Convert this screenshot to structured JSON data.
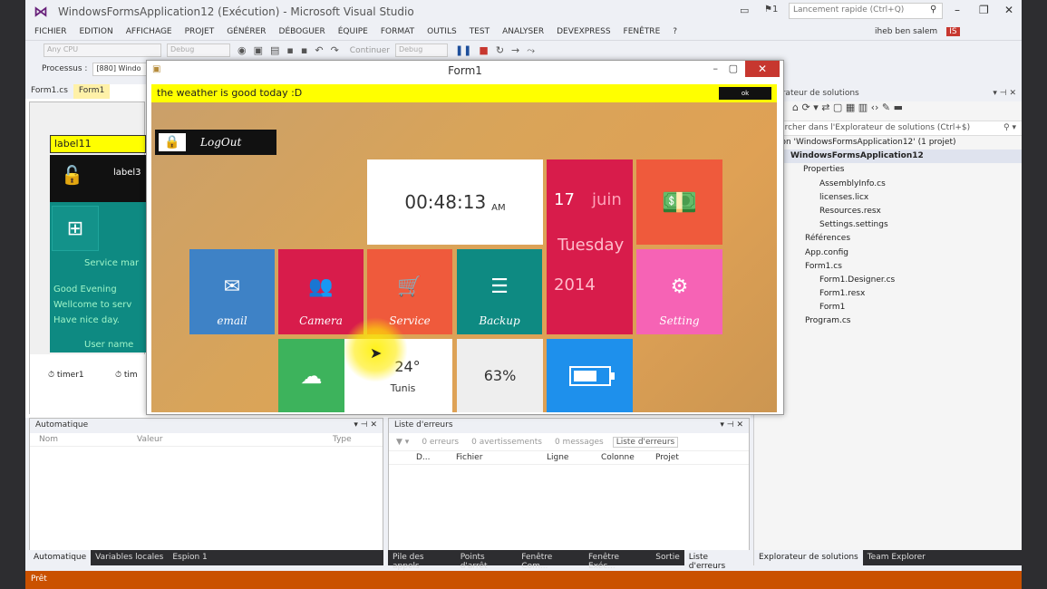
{
  "vs": {
    "title": "WindowsFormsApplication12 (Exécution) - Microsoft Visual Studio",
    "quick_launch": "Lancement rapide (Ctrl+Q)",
    "user": "iheb ben salem",
    "user_initials": "IS",
    "menu": [
      "FICHIER",
      "EDITION",
      "AFFICHAGE",
      "PROJET",
      "GÉNÉRER",
      "DÉBOGUER",
      "ÉQUIPE",
      "FORMAT",
      "OUTILS",
      "TEST",
      "ANALYSER",
      "DEVEXPRESS",
      "FENÊTRE",
      "?"
    ],
    "toolbar": {
      "cpu": "Any CPU",
      "config": "Debug",
      "continue": "Continuer",
      "debug2": "Debug"
    },
    "process_label": "Processus :",
    "process_value": "[880] Windo",
    "tabs": [
      "Form1.cs",
      "Form1"
    ],
    "status": "Prêt"
  },
  "designer": {
    "label11": "label11",
    "label3": "label3",
    "service_text": "Service mar",
    "greeting": [
      "Good Evening",
      "Wellcome to serv",
      "Have nice day."
    ],
    "user_name": "User name",
    "timer1": "timer1",
    "timer2": "tim"
  },
  "solution": {
    "header": "Explorateur de solutions",
    "search": "Rechercher dans l'Explorateur de solutions (Ctrl+$)",
    "items": [
      "Solution 'WindowsFormsApplication12' (1 projet)",
      "WindowsFormsApplication12",
      "Properties",
      "AssemblyInfo.cs",
      "licenses.licx",
      "Resources.resx",
      "Settings.settings",
      "Références",
      "App.config",
      "Form1.cs",
      "Form1.Designer.cs",
      "Form1.resx",
      "Form1",
      "Program.cs"
    ],
    "tabs": [
      "Explorateur de solutions",
      "Team Explorer"
    ]
  },
  "auto_panel": {
    "title": "Automatique",
    "cols": [
      "Nom",
      "Valeur",
      "Type"
    ],
    "tabs": [
      "Automatique",
      "Variables locales",
      "Espion 1"
    ]
  },
  "errors_panel": {
    "title": "Liste d'erreurs",
    "errors": "0 erreurs",
    "warnings": "0 avertissements",
    "messages": "0 messages",
    "search": "Liste d'erreurs",
    "cols": [
      "D...",
      "Fichier",
      "Ligne",
      "Colonne",
      "Projet"
    ],
    "tabs": [
      "Pile des appels",
      "Points d'arrêt",
      "Fenêtre Com...",
      "Fenêtre Exéc...",
      "Sortie",
      "Liste d'erreurs"
    ]
  },
  "form1": {
    "title": "Form1",
    "banner": "the weather is good today :D",
    "ok": "ok",
    "logout": "LogOut",
    "clock": "00:48:13",
    "ampm": "AM",
    "day": "17",
    "month": "juin",
    "weekday": "Tuesday",
    "year": "2014",
    "email": "email",
    "camera": "Camera",
    "service": "Service",
    "backup": "Backup",
    "setting": "Setting",
    "temp": "24°",
    "city": "Tunis",
    "battery": "63%"
  }
}
